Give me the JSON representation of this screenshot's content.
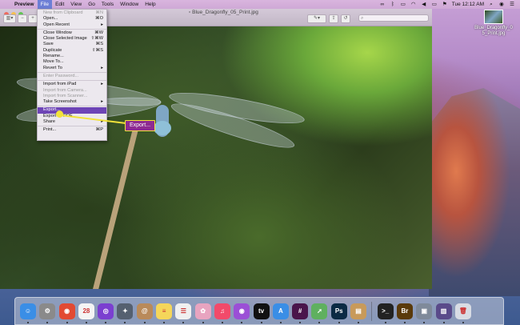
{
  "menubar": {
    "app_name": "Preview",
    "items": [
      "File",
      "Edit",
      "View",
      "Go",
      "Tools",
      "Window",
      "Help"
    ],
    "clock": "Tue 12:12 AM"
  },
  "window": {
    "title": "Blue_Dragonfly_05_Print.jpg"
  },
  "file_menu": [
    {
      "label": "New from Clipboard",
      "shortcut": "⌘N",
      "enabled": false
    },
    {
      "label": "Open...",
      "shortcut": "⌘O",
      "enabled": true
    },
    {
      "label": "Open Recent",
      "shortcut": "▸",
      "enabled": true
    },
    {
      "sep": true
    },
    {
      "label": "Close Window",
      "shortcut": "⌘W",
      "enabled": true
    },
    {
      "label": "Close Selected Image",
      "shortcut": "⇧⌘W",
      "enabled": true
    },
    {
      "label": "Save",
      "shortcut": "⌘S",
      "enabled": true
    },
    {
      "label": "Duplicate",
      "shortcut": "⇧⌘S",
      "enabled": true
    },
    {
      "label": "Rename...",
      "shortcut": "",
      "enabled": true
    },
    {
      "label": "Move To...",
      "shortcut": "",
      "enabled": true
    },
    {
      "label": "Revert To",
      "shortcut": "▸",
      "enabled": true
    },
    {
      "sep": true
    },
    {
      "label": "Enter Password...",
      "shortcut": "",
      "enabled": false
    },
    {
      "sep": true
    },
    {
      "label": "Import from iPad",
      "shortcut": "▸",
      "enabled": true
    },
    {
      "label": "Import from Camera...",
      "shortcut": "",
      "enabled": false
    },
    {
      "label": "Import from Scanner...",
      "shortcut": "",
      "enabled": false
    },
    {
      "label": "Take Screenshot",
      "shortcut": "▸",
      "enabled": true
    },
    {
      "sep": true
    },
    {
      "label": "Export...",
      "shortcut": "",
      "enabled": true,
      "highlighted": true
    },
    {
      "label": "Export as PDF...",
      "shortcut": "",
      "enabled": true
    },
    {
      "label": "Share",
      "shortcut": "▸",
      "enabled": true
    },
    {
      "sep": true
    },
    {
      "label": "Print...",
      "shortcut": "⌘P",
      "enabled": true
    }
  ],
  "callout": {
    "label": "Export..."
  },
  "desktop_file": {
    "name": "Blue_Dragonfly_0\n5_Print.jpg"
  },
  "dock": [
    {
      "name": "finder",
      "glyph": "☺",
      "color": "#3a8ee6"
    },
    {
      "name": "system-preferences",
      "glyph": "⚙",
      "color": "#8a8a8a"
    },
    {
      "name": "chrome",
      "glyph": "◉",
      "color": "#e24a33"
    },
    {
      "name": "calendar",
      "glyph": "28",
      "color": "#f4f4f4"
    },
    {
      "name": "siri",
      "glyph": "◎",
      "color": "#7b3fd0"
    },
    {
      "name": "launchpad",
      "glyph": "✦",
      "color": "#556070"
    },
    {
      "name": "contacts",
      "glyph": "@",
      "color": "#b98a5a"
    },
    {
      "name": "notes",
      "glyph": "≡",
      "color": "#f5d65a"
    },
    {
      "name": "reminders",
      "glyph": "☰",
      "color": "#f0f0f0"
    },
    {
      "name": "photos",
      "glyph": "✿",
      "color": "#e8a4c0"
    },
    {
      "name": "music",
      "glyph": "♫",
      "color": "#f24a6a"
    },
    {
      "name": "podcasts",
      "glyph": "◉",
      "color": "#9b4fd6"
    },
    {
      "name": "apple-tv",
      "glyph": "tv",
      "color": "#111111"
    },
    {
      "name": "app-store",
      "glyph": "A",
      "color": "#3a8ee6"
    },
    {
      "name": "slack",
      "glyph": "#",
      "color": "#4a154b"
    },
    {
      "name": "maps",
      "glyph": "➚",
      "color": "#5fb05f"
    },
    {
      "name": "photoshop",
      "glyph": "Ps",
      "color": "#0b2a44"
    },
    {
      "name": "preview",
      "glyph": "▤",
      "color": "#c89a5a"
    },
    {
      "name": "terminal",
      "glyph": ">_",
      "color": "#222222"
    },
    {
      "name": "bridge",
      "glyph": "Br",
      "color": "#5a3a0a"
    },
    {
      "name": "image-capture",
      "glyph": "▣",
      "color": "#7f8a9a"
    },
    {
      "name": "downloads",
      "glyph": "▥",
      "color": "#5a4a8a"
    },
    {
      "name": "trash",
      "glyph": "🗑",
      "color": "#d8dce4"
    }
  ]
}
